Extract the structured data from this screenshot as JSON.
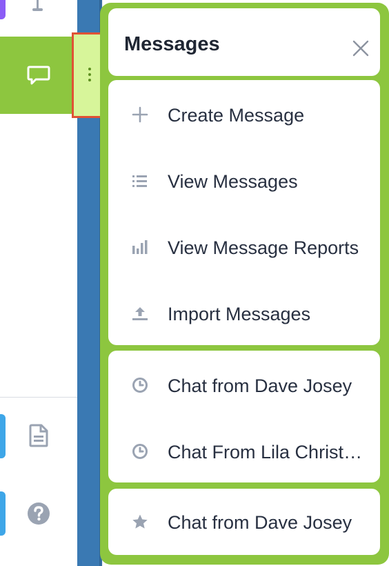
{
  "colors": {
    "accent_green": "#8dc63f",
    "sidebar_blue": "#3a79b3",
    "highlight_red": "#e05235",
    "icon_gray": "#9aa3b2",
    "text_dark": "#283041"
  },
  "sidebar": {
    "icons": [
      "flag-icon",
      "chat-bubble-icon",
      "document-icon",
      "help-icon"
    ]
  },
  "popover": {
    "title": "Messages",
    "close_icon": "close-icon",
    "groups": [
      {
        "items": [
          {
            "label": "Create Message",
            "icon": "plus-icon"
          },
          {
            "label": "View Messages",
            "icon": "list-icon"
          },
          {
            "label": "View Message Reports",
            "icon": "bar-chart-icon"
          },
          {
            "label": "Import Messages",
            "icon": "upload-icon"
          }
        ]
      },
      {
        "items": [
          {
            "label": "Chat from Dave Josey",
            "icon": "clock-icon"
          },
          {
            "label": "Chat From Lila Christensen",
            "icon": "clock-icon"
          }
        ]
      },
      {
        "items": [
          {
            "label": "Chat from Dave Josey",
            "icon": "star-icon"
          }
        ]
      }
    ]
  }
}
